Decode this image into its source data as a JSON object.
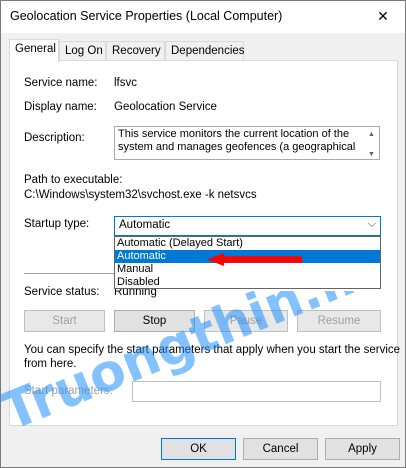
{
  "window": {
    "title": "Geolocation Service Properties (Local Computer)",
    "close_glyph": "✕"
  },
  "tabs": [
    {
      "label": "General",
      "active": true
    },
    {
      "label": "Log On"
    },
    {
      "label": "Recovery"
    },
    {
      "label": "Dependencies"
    }
  ],
  "general": {
    "service_name_label": "Service name:",
    "service_name_value": "lfsvc",
    "display_name_label": "Display name:",
    "display_name_value": "Geolocation Service",
    "description_label": "Description:",
    "description_value": "This service monitors the current location of the system and manages geofences (a geographical",
    "path_label": "Path to executable:",
    "path_value": "C:\\Windows\\system32\\svchost.exe -k netsvcs",
    "startup_type_label": "Startup type:",
    "startup_type_value": "Automatic",
    "startup_options": [
      "Automatic (Delayed Start)",
      "Automatic",
      "Manual",
      "Disabled"
    ],
    "service_status_label": "Service status:",
    "service_status_value": "Running",
    "buttons": {
      "start": "Start",
      "stop": "Stop",
      "pause": "Pause",
      "resume": "Resume"
    },
    "hint_line1": "You can specify the start parameters that apply when you start the service",
    "hint_line2": "from here.",
    "start_params_label": "Start parameters:"
  },
  "footer": {
    "ok": "OK",
    "cancel": "Cancel",
    "apply": "Apply"
  },
  "watermark": {
    "text": "Truongthin.info",
    "color": "#1e90ff"
  },
  "colors": {
    "accent": "#0078d7",
    "annotation": "#ff0000"
  }
}
